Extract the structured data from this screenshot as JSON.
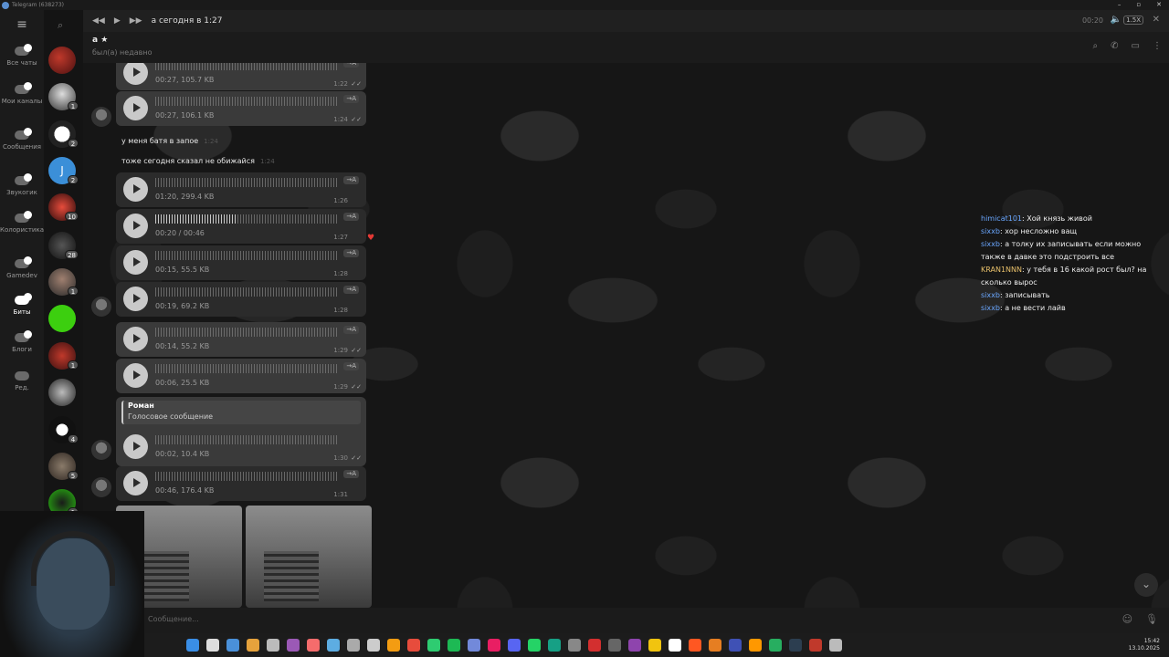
{
  "window": {
    "title": "Telegram (638273)",
    "minimize": "–",
    "maximize": "▫",
    "close": "✕"
  },
  "folders": [
    {
      "label": "Все чаты"
    },
    {
      "label": "Мои каналы"
    },
    {
      "label": "Сообщения"
    },
    {
      "label": "Звукогик"
    },
    {
      "label": "Колористика"
    },
    {
      "label": "Gamedev"
    },
    {
      "label": "Биты"
    },
    {
      "label": "Блоги"
    },
    {
      "label": "Ред."
    }
  ],
  "chat_badges": [
    "",
    "1",
    "2",
    "2",
    "10",
    "28",
    "1",
    "",
    "1",
    "",
    "4",
    "5",
    "1"
  ],
  "player": {
    "title": "а сегодня в 1:27",
    "time": "00:20",
    "speed": "1.5X"
  },
  "chat": {
    "name": "а ★",
    "status": "был(а) недавно"
  },
  "messages": [
    {
      "kind": "voice",
      "meta": "00:27, 105.7 KB",
      "time": "1:22",
      "out": true
    },
    {
      "kind": "voice",
      "meta": "00:27, 106.1 KB",
      "time": "1:24",
      "out": true
    },
    {
      "kind": "text",
      "text": "у меня батя в запое",
      "time": "1:24"
    },
    {
      "kind": "text",
      "text": "тоже сегодня сказал не обижайся",
      "time": "1:24"
    },
    {
      "kind": "voice",
      "meta": "01:20, 299.4 KB",
      "time": "1:26",
      "out": false
    },
    {
      "kind": "voice",
      "meta": "00:20 / 00:46",
      "time": "1:27",
      "out": false
    },
    {
      "kind": "voice",
      "meta": "00:15, 55.5 KB",
      "time": "1:28",
      "out": false
    },
    {
      "kind": "voice",
      "meta": "00:19, 69.2 KB",
      "time": "1:28",
      "out": false
    },
    {
      "kind": "voice",
      "meta": "00:14, 55.2 KB",
      "time": "1:29",
      "out": true
    },
    {
      "kind": "voice",
      "meta": "00:06, 25.5 KB",
      "time": "1:29",
      "out": true
    },
    {
      "kind": "reply",
      "reply_name": "Роман",
      "reply_text": "Голосовое сообщение",
      "meta": "00:02, 10.4 KB",
      "time": "1:30",
      "out": true
    },
    {
      "kind": "voice",
      "meta": "00:46, 176.4 KB",
      "time": "1:31",
      "out": false
    }
  ],
  "translate_label": "→A",
  "stream_chat": [
    {
      "user": "himicat101",
      "text": "Хой князь живой"
    },
    {
      "user": "sixxb",
      "text": "хор несложно ващ"
    },
    {
      "user": "sixxb",
      "text": "а толку их записывать если можно также в давке это подстроить все"
    },
    {
      "user": "KRAN1NNN",
      "text": "у тебя в 16 какой рост был? на сколько вырос"
    },
    {
      "user": "sixxb",
      "text": "записывать"
    },
    {
      "user": "sixxb",
      "text": "а не вести лайв"
    }
  ],
  "composer": {
    "placeholder": "Сообщение..."
  },
  "taskbar": {
    "time": "15:42",
    "date": "13.10.2025",
    "icon_colors": [
      "#3a8ee6",
      "#ddd",
      "#4a90d9",
      "#e6a23c",
      "#bbb",
      "#9b59b6",
      "#f56c6c",
      "#5dade2",
      "#aaa",
      "#ccc",
      "#f39c12",
      "#e74c3c",
      "#2ecc71",
      "#1db954",
      "#7289da",
      "#e91e63",
      "#5865f2",
      "#25d366",
      "#16a085",
      "#888",
      "#d32f2f",
      "#666",
      "#8e44ad",
      "#f1c40f",
      "#fff",
      "#ff5722",
      "#e67e22",
      "#3f51b5",
      "#ff9800",
      "#27ae60",
      "#2c3e50",
      "#c0392b",
      "#bbb"
    ]
  }
}
